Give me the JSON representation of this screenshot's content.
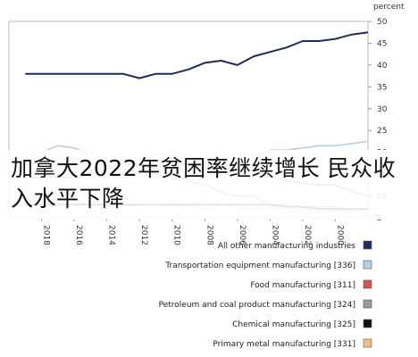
{
  "headline": "加拿大2022年贫困率继续增长 民众收入水平下降",
  "chart_data": {
    "type": "line",
    "ylabel": "percent",
    "ylim": [
      5,
      50
    ],
    "yticks": [
      "5",
      "10",
      "15",
      "20",
      "25",
      "30",
      "35",
      "40",
      "45",
      "50"
    ],
    "x": [
      1998,
      1999,
      2000,
      2001,
      2002,
      2003,
      2004,
      2005,
      2006,
      2007,
      2008,
      2009,
      2010,
      2011,
      2012,
      2013,
      2014,
      2015,
      2016,
      2017,
      2018,
      2019
    ],
    "xticks": [
      "2000",
      "2002",
      "2004",
      "2006",
      "2008",
      "2010",
      "2012",
      "2014",
      "2016",
      "2018"
    ],
    "series": [
      {
        "name": "All other manufacturing industries",
        "color": "#1f2a5e",
        "values": [
          47.5,
          47.0,
          46.0,
          45.5,
          45.5,
          44.0,
          43.0,
          42.0,
          40.0,
          41.0,
          40.5,
          39.0,
          38.0,
          38.0,
          37.0,
          38.0,
          38.0,
          38.0,
          38.0,
          38.0,
          38.0,
          38.0
        ]
      },
      {
        "name": "Transportation equipment manufacturing [336]",
        "color": "#b9cfe4",
        "values": [
          22.5,
          22.0,
          21.5,
          21.5,
          21.0,
          20.5,
          20.5,
          19.0,
          17.5,
          16.0,
          16.5,
          16.0,
          16.5,
          17.0,
          17.5,
          18.5,
          17.5,
          19.5,
          21.0,
          21.5,
          20.0,
          19.5
        ]
      },
      {
        "name": "Food manufacturing [311]",
        "color": "#d9534f",
        "values": [
          10.0,
          11.0,
          12.5,
          12.5,
          13.0,
          13.5,
          14.5,
          16.0,
          16.0,
          16.5,
          17.0,
          17.5,
          16.5,
          16.5,
          17.0,
          17.5,
          16.0,
          15.0,
          14.0,
          14.5,
          14.0,
          14.5
        ]
      },
      {
        "name": "Petroleum and coal product manufacturing [324]",
        "color": "#9a9a9a",
        "values": [
          6.5,
          6.5,
          7.5,
          7.5,
          7.5,
          8.0,
          8.0,
          10.0,
          10.0,
          11.0,
          12.5,
          13.5,
          14.0,
          15.0,
          15.5,
          16.0,
          17.0,
          17.5,
          17.0,
          17.0,
          17.5,
          17.5
        ]
      },
      {
        "name": "Chemical manufacturing [325]",
        "color": "#111111",
        "values": [
          7.0,
          7.0,
          7.0,
          7.0,
          7.5,
          7.5,
          8.0,
          8.0,
          8.0,
          8.0,
          8.0,
          8.0,
          8.0,
          8.0,
          8.0,
          8.0,
          8.0,
          8.0,
          8.0,
          8.0,
          8.0,
          8.0
        ]
      },
      {
        "name": "Primary metal manufacturing [331]",
        "color": "#f0c080",
        "values": [
          6.5,
          6.5,
          6.5,
          6.5,
          7.0,
          7.0,
          7.5,
          7.0,
          7.5,
          8.0,
          7.0,
          8.0,
          7.5,
          8.0,
          8.0,
          7.5,
          7.0,
          8.0,
          8.5,
          8.0,
          7.5,
          8.0
        ]
      }
    ]
  }
}
